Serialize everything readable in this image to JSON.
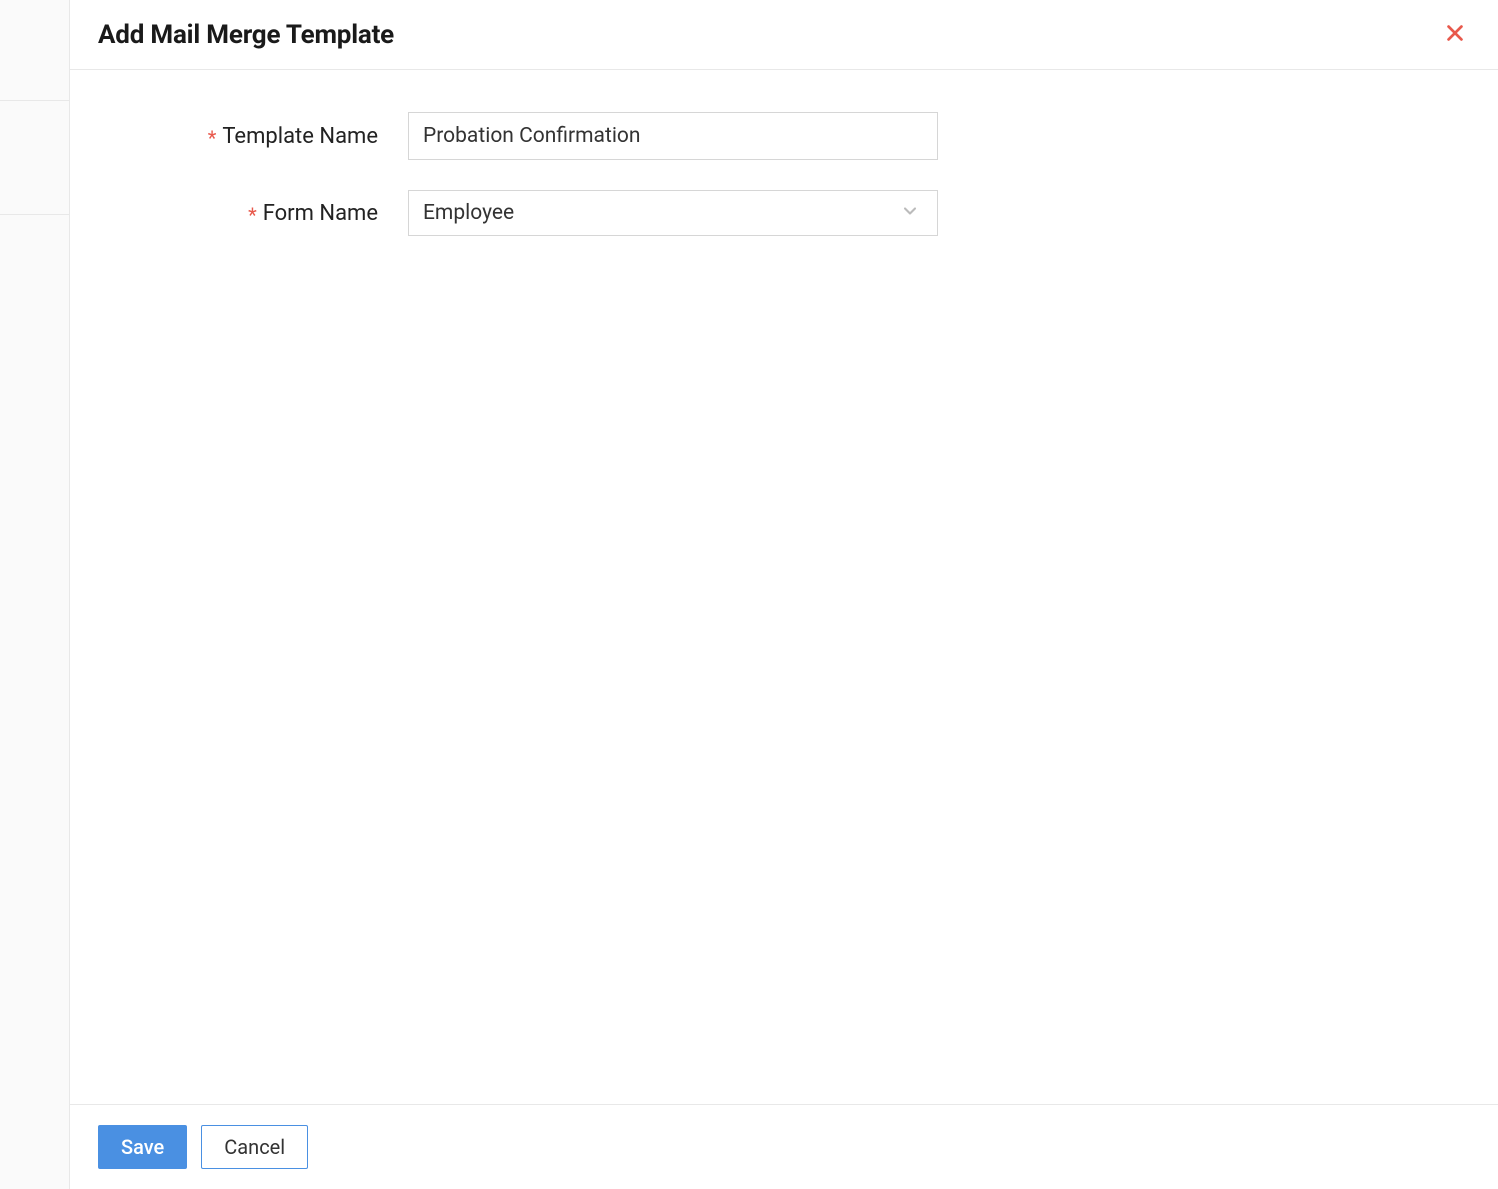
{
  "modal": {
    "title": "Add Mail Merge Template",
    "fields": {
      "template_name": {
        "label": "Template Name",
        "value": "Probation Confirmation",
        "required": true
      },
      "form_name": {
        "label": "Form Name",
        "value": "Employee",
        "required": true
      }
    },
    "buttons": {
      "save": "Save",
      "cancel": "Cancel"
    }
  }
}
